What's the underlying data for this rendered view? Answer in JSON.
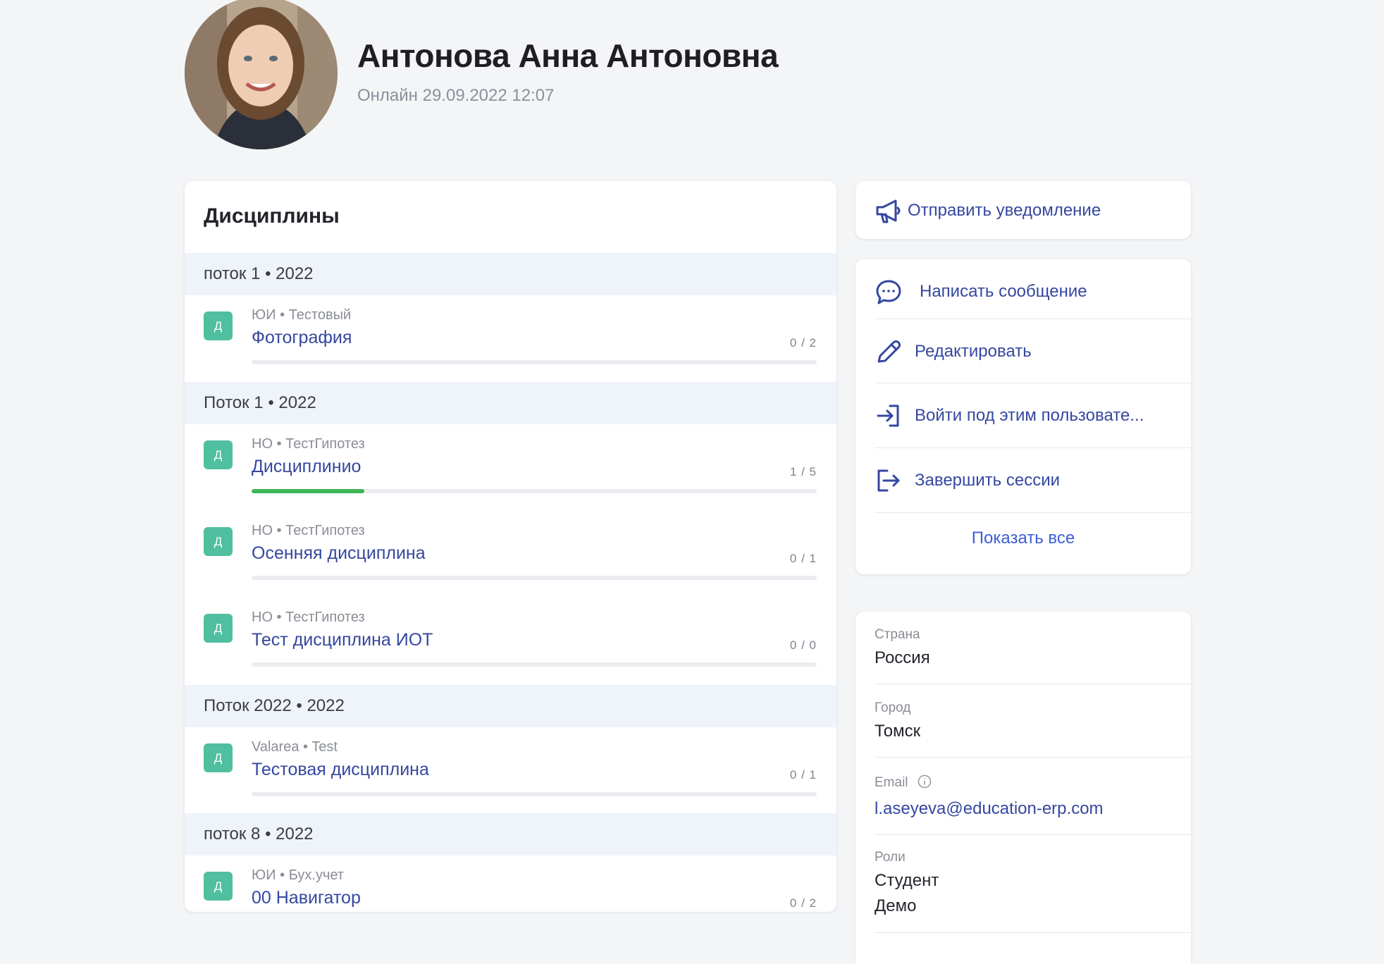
{
  "profile": {
    "name": "Антонова Анна Антоновна",
    "status": "Онлайн 29.09.2022 12:07"
  },
  "disciplines": {
    "title": "Дисциплины",
    "badge_letter": "Д",
    "groups": [
      {
        "header": "поток 1 • 2022",
        "items": [
          {
            "meta": "ЮИ • Тестовый",
            "name": "Фотография",
            "count": "0 / 2",
            "progress": 0
          }
        ]
      },
      {
        "header": "Поток 1 • 2022",
        "items": [
          {
            "meta": "НО • ТестГипотез",
            "name": "Дисциплинио",
            "count": "1 / 5",
            "progress": 0.2
          },
          {
            "meta": "НО • ТестГипотез",
            "name": "Осенняя дисциплина",
            "count": "0 / 1",
            "progress": 0
          },
          {
            "meta": "НО • ТестГипотез",
            "name": "Тест дисциплина ИОТ",
            "count": "0 / 0",
            "progress": 0
          }
        ]
      },
      {
        "header": "Поток 2022 • 2022",
        "items": [
          {
            "meta": "Valarea • Test",
            "name": "Тестовая дисциплина",
            "count": "0 / 1",
            "progress": 0
          }
        ]
      },
      {
        "header": "поток 8 • 2022",
        "items": [
          {
            "meta": "ЮИ • Бух.учет",
            "name": "00 Навигатор",
            "count": "0 / 2",
            "progress": 0
          }
        ]
      }
    ]
  },
  "actions": {
    "notify": "Отправить уведомление",
    "message": "Написать сообщение",
    "edit": "Редактировать",
    "login_as": "Войти под этим пользовате...",
    "end_sessions": "Завершить сессии",
    "show_all": "Показать все"
  },
  "info": {
    "country_label": "Страна",
    "country": "Россия",
    "city_label": "Город",
    "city": "Томск",
    "email_label": "Email",
    "email": "l.aseyeva@education-erp.com",
    "roles_label": "Роли",
    "roles": [
      "Студент",
      "Демо"
    ]
  },
  "colors": {
    "accent": "#3547a0",
    "badge": "#4fbf9f",
    "progress": "#3eb558",
    "group_bg": "#eff3fa"
  }
}
